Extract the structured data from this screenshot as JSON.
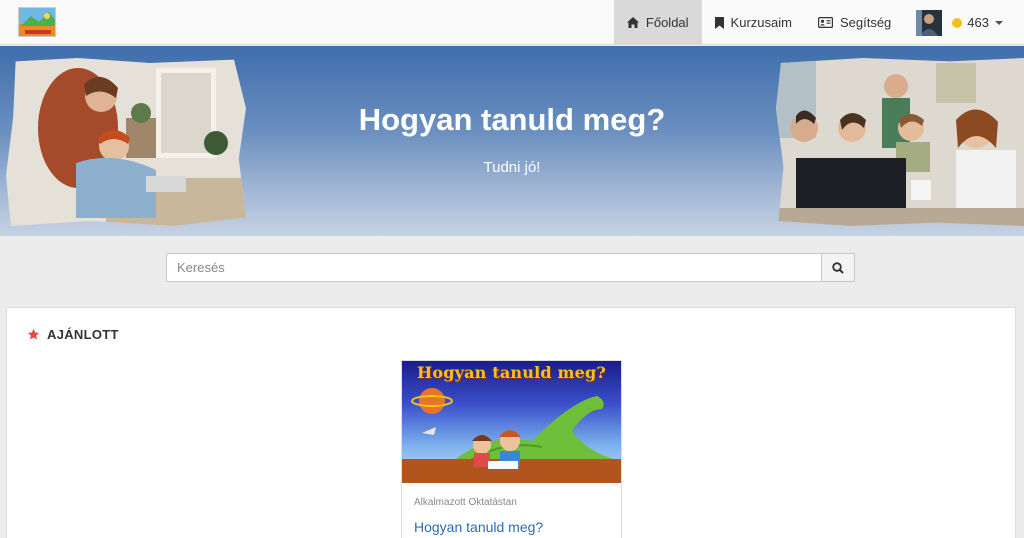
{
  "nav": {
    "items": [
      {
        "label": "Főoldal",
        "icon": "home-icon",
        "active": true
      },
      {
        "label": "Kurzusaim",
        "icon": "bookmark-icon",
        "active": false
      },
      {
        "label": "Segítség",
        "icon": "id-card-icon",
        "active": false
      }
    ],
    "user": {
      "points": "463"
    }
  },
  "hero": {
    "title": "Hogyan tanuld meg?",
    "subtitle": "Tudni jó!"
  },
  "search": {
    "placeholder": "Keresés",
    "value": ""
  },
  "featured": {
    "heading": "AJÁNLOTT",
    "card": {
      "image_title": "Hogyan tanuld meg?",
      "category": "Alkalmazott Oktatástan",
      "title": "Hogyan tanuld meg?"
    }
  },
  "colors": {
    "accent_link": "#2a6db4",
    "star": "#e04a4a",
    "coin": "#f2c21b",
    "hero_top": "#3f6eab"
  }
}
